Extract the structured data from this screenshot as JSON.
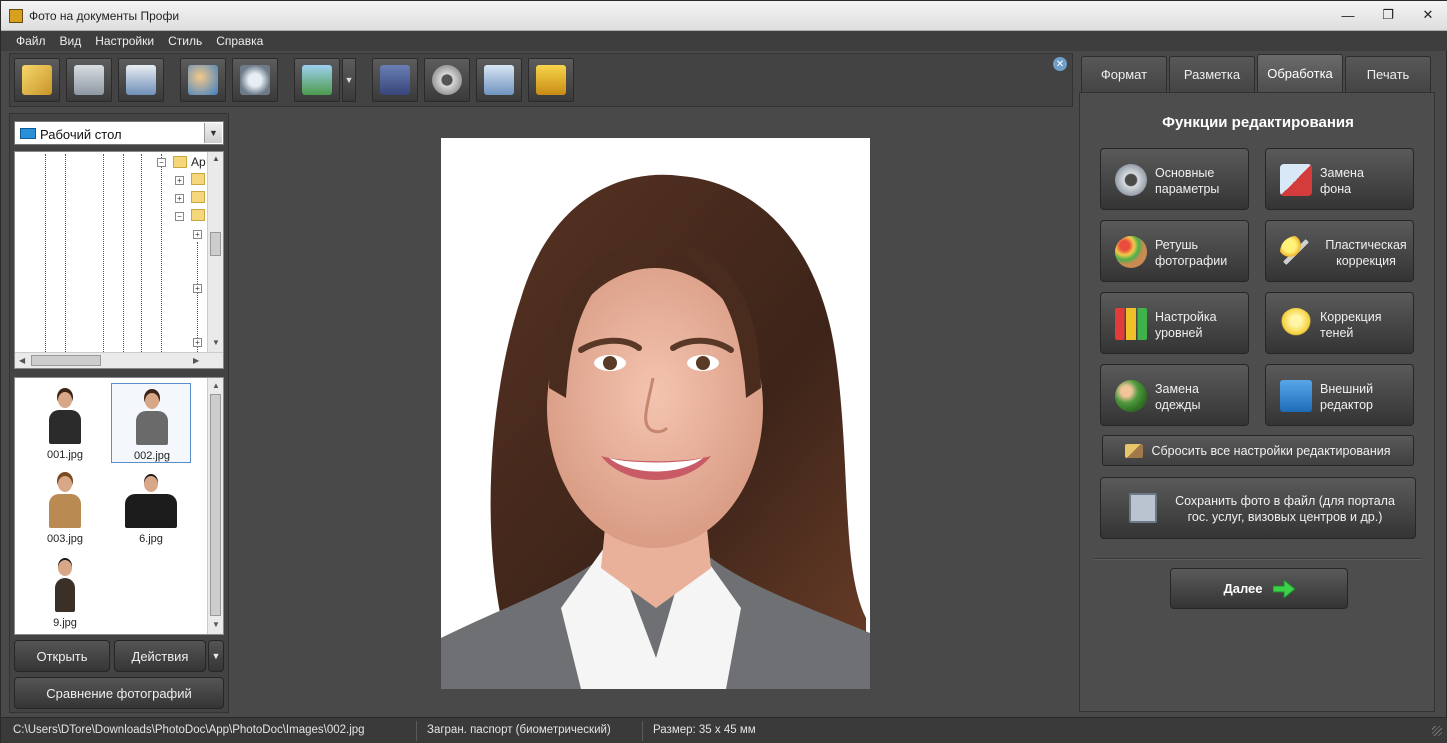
{
  "window": {
    "title": "Фото на документы Профи",
    "minimize": "—",
    "maximize": "❐",
    "close": "✕"
  },
  "menu": [
    "Файл",
    "Вид",
    "Настройки",
    "Стиль",
    "Справка"
  ],
  "toolbar": {
    "close_glyph": "✕",
    "dropdown_glyph": "▼"
  },
  "left": {
    "folder": "Рабочий стол",
    "folder_arrow": "▼",
    "tree_node_text": "Ap",
    "thumbnails": [
      "001.jpg",
      "002.jpg",
      "003.jpg",
      "6.jpg",
      "9.jpg"
    ],
    "open_button": "Открыть",
    "actions_button": "Действия",
    "actions_arrow": "▼",
    "compare_button": "Сравнение фотографий"
  },
  "tabs": [
    "Формат",
    "Разметка",
    "Обработка",
    "Печать"
  ],
  "right": {
    "title": "Функции редактирования",
    "functions": [
      "Основные\nпараметры",
      "Замена\nфона",
      "Ретушь\nфотографии",
      "Пластическая\nкоррекция",
      "Настройка\nуровней",
      "Коррекция\nтеней",
      "Замена\nодежды",
      "Внешний\nредактор"
    ],
    "reset": "Сбросить все настройки редактирования",
    "save": "Сохранить фото в файл (для портала\nгос. услуг, визовых центров и др.)",
    "next": "Далее"
  },
  "status": {
    "path": "C:\\Users\\DTore\\Downloads\\PhotoDoc\\App\\PhotoDoc\\Images\\002.jpg",
    "format": "Загран. паспорт (биометрический)",
    "size": "Размер: 35 x 45 мм"
  },
  "colors": {
    "accent_green": "#3bd14a",
    "panel_bg": "#4d4d4d",
    "selection_border": "#5b8fc9"
  }
}
